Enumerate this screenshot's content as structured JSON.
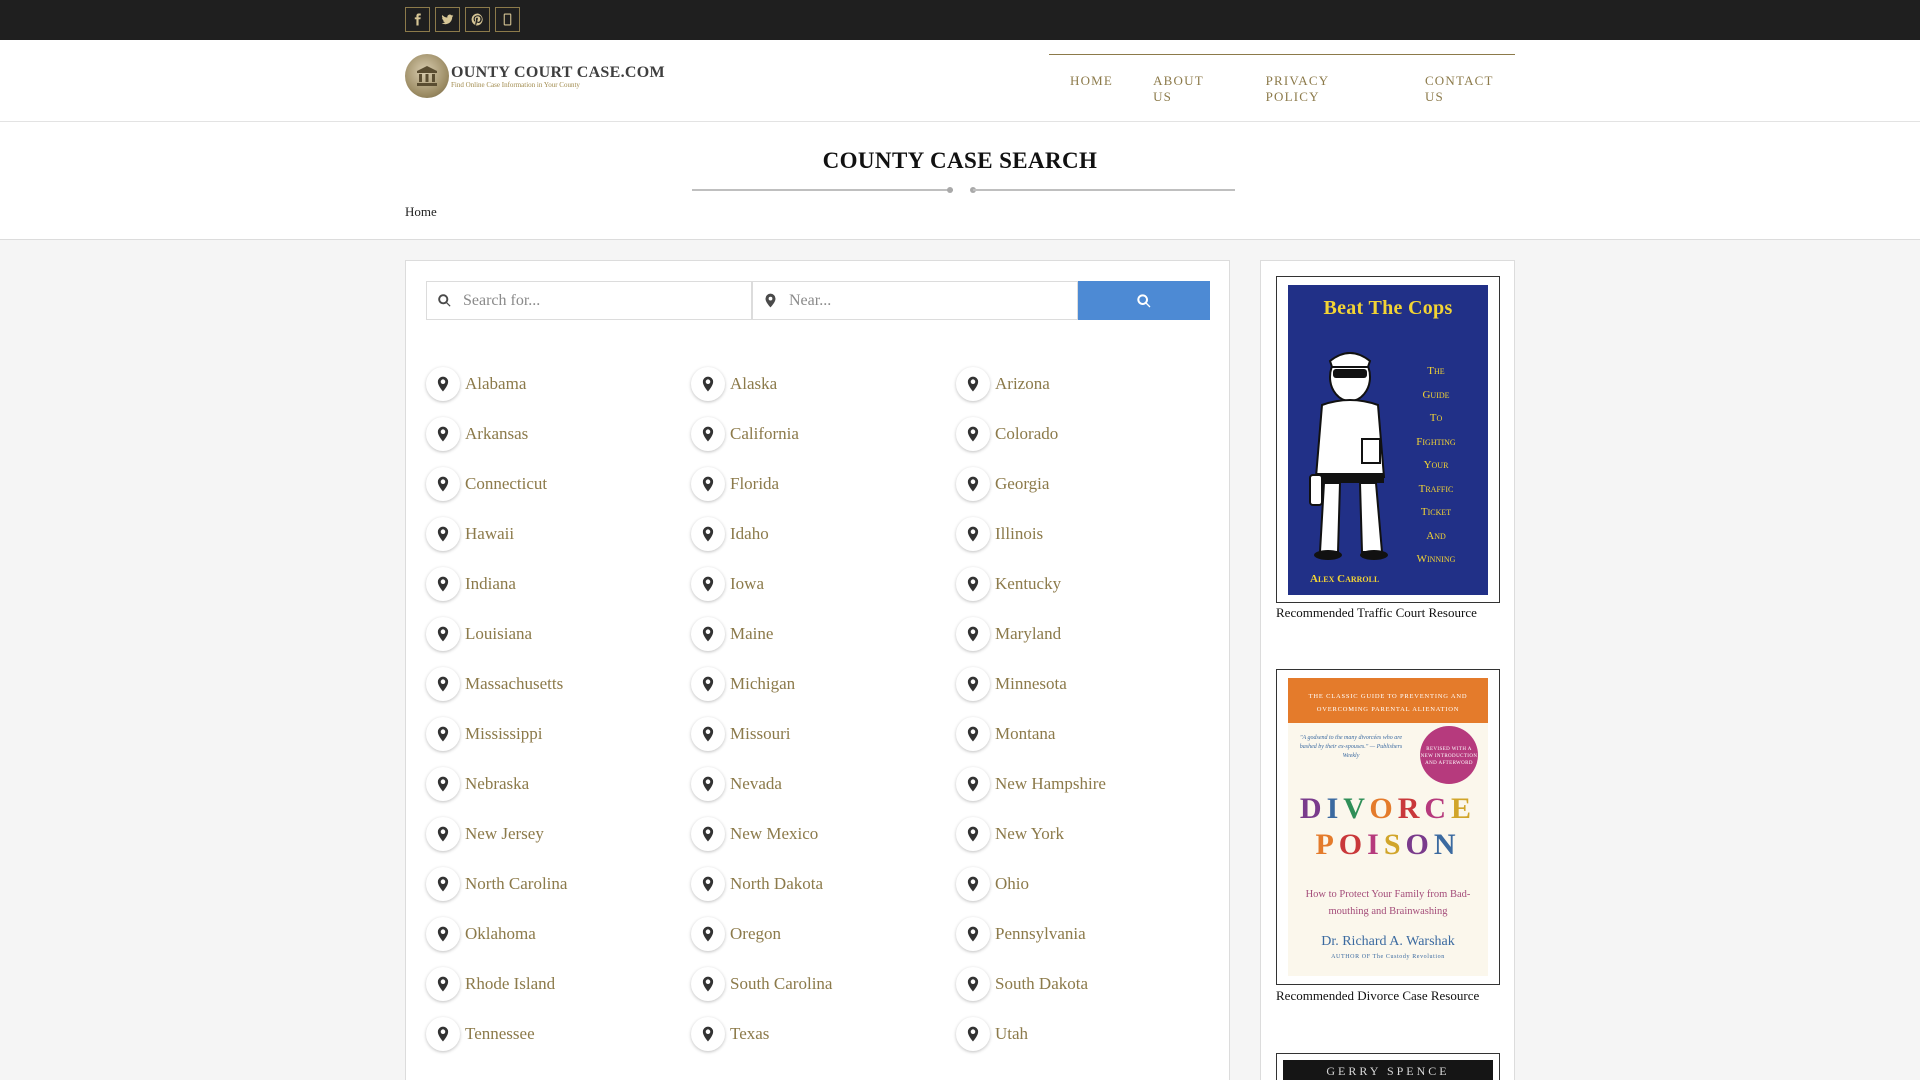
{
  "header": {
    "social_icons": [
      "facebook-icon",
      "twitter-icon",
      "pinterest-icon",
      "instagram-icon"
    ],
    "logo": {
      "name": "OUNTY COURT CASE.COM",
      "tagline": "Find Online Case Information in Your County"
    },
    "nav": [
      {
        "label": "HOME"
      },
      {
        "label": "ABOUT US"
      },
      {
        "label": "PRIVACY POLICY"
      },
      {
        "label": "CONTACT US"
      }
    ]
  },
  "page": {
    "title": "COUNTY CASE SEARCH",
    "breadcrumb": "Home"
  },
  "search": {
    "keyword_placeholder": "Search for...",
    "location_placeholder": "Near...",
    "button_icon": "search-icon"
  },
  "states": [
    "Alabama",
    "Alaska",
    "Arizona",
    "Arkansas",
    "California",
    "Colorado",
    "Connecticut",
    "Florida",
    "Georgia",
    "Hawaii",
    "Idaho",
    "Illinois",
    "Indiana",
    "Iowa",
    "Kentucky",
    "Louisiana",
    "Maine",
    "Maryland",
    "Massachusetts",
    "Michigan",
    "Minnesota",
    "Mississippi",
    "Missouri",
    "Montana",
    "Nebraska",
    "Nevada",
    "New Hampshire",
    "New Jersey",
    "New Mexico",
    "New York",
    "North Carolina",
    "North Dakota",
    "Ohio",
    "Oklahoma",
    "Oregon",
    "Pennsylvania",
    "Rhode Island",
    "South Carolina",
    "South Dakota",
    "Tennessee",
    "Texas",
    "Utah"
  ],
  "sidebar": {
    "book1": {
      "title": "Beat The Cops",
      "subtitle": [
        "The",
        "Guide",
        "To",
        "Fighting",
        "Your",
        "Traffic",
        "Ticket",
        "And",
        "Winning"
      ],
      "author": "Alex Carroll",
      "caption": "Recommended Traffic Court Resource"
    },
    "book2": {
      "band": "THE CLASSIC GUIDE TO PREVENTING AND OVERCOMING PARENTAL ALIENATION",
      "quote": "\"A godsend to the many divorcées who are bashed by their ex-spouses.\" — Publishers Weekly",
      "badge": "REVISED WITH A NEW INTRODUCTION AND AFTERWORD",
      "title_line1": "DIVORCE",
      "title_line2": "POISON",
      "subtitle": "How to Protect Your Family from Bad-mouthing and Brainwashing",
      "author": "Dr. Richard A. Warshak",
      "note": "AUTHOR OF The Custody Revolution",
      "caption": "Recommended Divorce Case Resource",
      "colors": [
        "#7a3b8c",
        "#3b6aa0",
        "#2f8f58",
        "#e47b2b",
        "#c9383a",
        "#b63a7d",
        "#d1a52a"
      ]
    },
    "book3": {
      "author": "GERRY SPENCE"
    }
  }
}
